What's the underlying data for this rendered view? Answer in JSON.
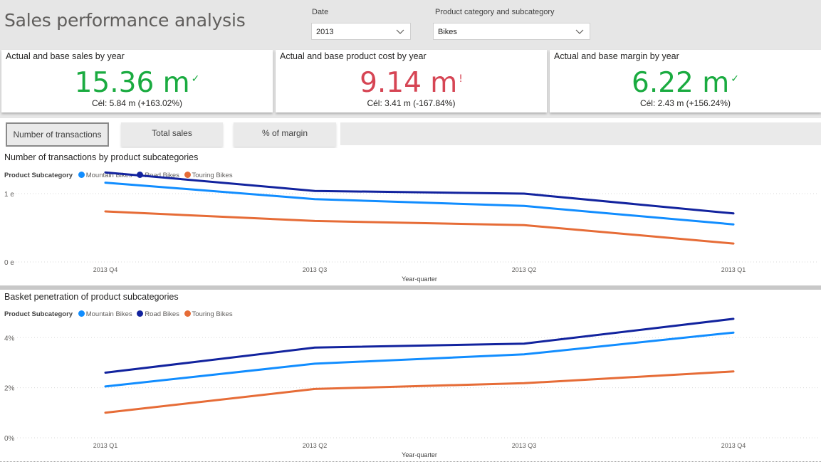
{
  "page_title": "Sales performance analysis",
  "slicers": {
    "date": {
      "label": "Date",
      "value": "2013"
    },
    "category": {
      "label": "Product category and subcategory",
      "value": "Bikes"
    }
  },
  "kpis": [
    {
      "title": "Actual and base sales by year",
      "value": "15.36 m",
      "mark": "✓",
      "status": "good",
      "goal": "Cél: 5.84 m (+163.02%)"
    },
    {
      "title": "Actual and base product cost by year",
      "value": "9.14 m",
      "mark": "!",
      "status": "bad",
      "goal": "Cél: 3.41 m (-167.84%)"
    },
    {
      "title": "Actual and base margin by year",
      "value": "6.22 m",
      "mark": "✓",
      "status": "good",
      "goal": "Cél: 2.43 m (+156.24%)"
    }
  ],
  "tabs": [
    {
      "label": "Number of transactions",
      "active": true
    },
    {
      "label": "Total sales",
      "active": false
    },
    {
      "label": "% of margin",
      "active": false
    }
  ],
  "colors": {
    "mountain": "#118dff",
    "road": "#12239e",
    "touring": "#e66c37",
    "good": "#1aab40",
    "bad": "#d64554"
  },
  "chart_data": [
    {
      "type": "line",
      "title": "Number of transactions by product subcategories",
      "legend_title": "Product Subcategory",
      "xlabel": "Year-quarter",
      "categories": [
        "2013 Q4",
        "2013 Q3",
        "2013 Q2",
        "2013 Q1"
      ],
      "yticks": [
        {
          "value": 0,
          "label": "0 e"
        },
        {
          "value": 1,
          "label": "1 e"
        }
      ],
      "ylim": [
        0,
        1.25
      ],
      "series": [
        {
          "name": "Mountain Bikes",
          "color": "#118dff",
          "values": [
            1.16,
            0.92,
            0.82,
            0.55
          ]
        },
        {
          "name": "Road Bikes",
          "color": "#12239e",
          "values": [
            1.31,
            1.04,
            1.0,
            0.71
          ]
        },
        {
          "name": "Touring Bikes",
          "color": "#e66c37",
          "values": [
            0.74,
            0.6,
            0.54,
            0.27
          ]
        }
      ]
    },
    {
      "type": "line",
      "title": "Basket penetration of product subcategories",
      "legend_title": "Product Subcategory",
      "xlabel": "Year-quarter",
      "categories": [
        "2013 Q1",
        "2013 Q2",
        "2013 Q3",
        "2013 Q4"
      ],
      "yticks": [
        {
          "value": 0,
          "label": "0%"
        },
        {
          "value": 2,
          "label": "2%"
        },
        {
          "value": 4,
          "label": "4%"
        }
      ],
      "ylim": [
        0,
        5.4
      ],
      "series": [
        {
          "name": "Mountain Bikes",
          "color": "#118dff",
          "values": [
            2.05,
            2.96,
            3.33,
            4.2
          ]
        },
        {
          "name": "Road Bikes",
          "color": "#12239e",
          "values": [
            2.6,
            3.6,
            3.76,
            4.75
          ]
        },
        {
          "name": "Touring Bikes",
          "color": "#e66c37",
          "values": [
            1.0,
            1.95,
            2.18,
            2.65
          ]
        }
      ]
    }
  ]
}
